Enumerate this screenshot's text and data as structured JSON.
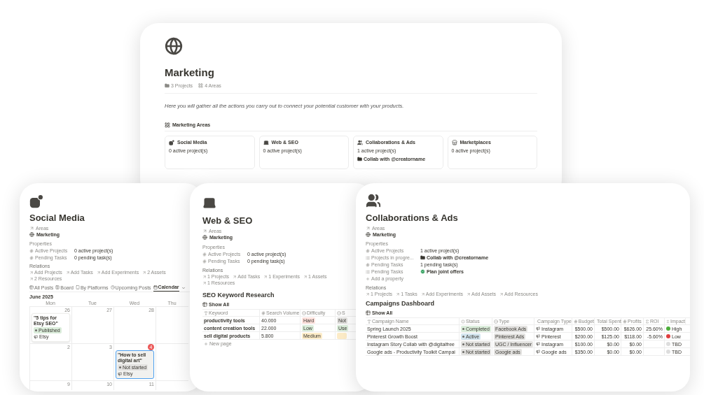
{
  "marketing": {
    "title": "Marketing",
    "meta": [
      {
        "kind": "projects",
        "label": "3 Projects"
      },
      {
        "kind": "areas",
        "label": "4 Areas"
      }
    ],
    "description": "Here you will gather all the actions you carry out to connect your potential customer with your products.",
    "section": "Marketing Areas",
    "areas": [
      {
        "kind": "social",
        "name": "Social Media",
        "count": "0 active project(s)"
      },
      {
        "kind": "web",
        "name": "Web & SEO",
        "count": "0 active project(s)"
      },
      {
        "kind": "collab",
        "name": "Collaborations & Ads",
        "count": "1 active project(s)",
        "project": "Collab with @creatorname"
      },
      {
        "kind": "market",
        "name": "Marketplaces",
        "count": "0 active project(s)"
      }
    ]
  },
  "social": {
    "title": "Social Media",
    "areas_label": "Areas",
    "area": "Marketing",
    "properties_label": "Properties",
    "properties": [
      {
        "kind": "number",
        "label": "Active Projects",
        "value": "0 active project(s)"
      },
      {
        "kind": "number",
        "label": "Pending Tasks",
        "value": "0 pending task(s)"
      }
    ],
    "relations_label": "Relations",
    "relations": [
      "Add Projects",
      "Add Tasks",
      "Add Experiments",
      "2 Assets",
      "2 Resources"
    ],
    "views": [
      {
        "kind": "table",
        "label": "All Posts",
        "selected": false
      },
      {
        "kind": "board",
        "label": "Board",
        "selected": false
      },
      {
        "kind": "platforms",
        "label": "By Platforms",
        "selected": false
      },
      {
        "kind": "upcoming",
        "label": "Upcoming Posts",
        "selected": false
      },
      {
        "kind": "calendar",
        "label": "Calendar",
        "selected": true
      }
    ],
    "calendar": {
      "month": "June 2025",
      "weekdays": [
        "Mon",
        "Tue",
        "Wed",
        "Thu"
      ],
      "weeks": [
        [
          {
            "day": "26",
            "today": false,
            "event": {
              "title": "\"5 tips for Etsy SEO\"",
              "status": "Published",
              "color": "#dbeddb",
              "platform": "Etsy",
              "selected": false
            }
          },
          {
            "day": "27",
            "today": false
          },
          {
            "day": "28",
            "today": false
          }
        ],
        [
          {
            "day": "2",
            "today": false
          },
          {
            "day": "3",
            "today": false
          },
          {
            "day": "4",
            "today": true,
            "event": {
              "title": "\"How to sell digital art\"",
              "status": "Not started",
              "color": "#e3e2e0",
              "platform": "Etsy",
              "selected": true
            }
          }
        ],
        [
          {
            "day": "9",
            "today": false
          },
          {
            "day": "10",
            "today": false
          },
          {
            "day": "11",
            "today": false
          }
        ]
      ]
    }
  },
  "web": {
    "title": "Web & SEO",
    "areas_label": "Areas",
    "area": "Marketing",
    "properties_label": "Properties",
    "properties": [
      {
        "kind": "number",
        "label": "Active Projects",
        "value": "0 active project(s)"
      },
      {
        "kind": "number",
        "label": "Pending Tasks",
        "value": "0 pending task(s)"
      }
    ],
    "relations_label": "Relations",
    "relations": [
      "1 Projects",
      "Add Tasks",
      "1 Experiments",
      "1 Assets",
      "1 Resources"
    ],
    "table": {
      "title": "SEO Keyword Research",
      "view": "Show All",
      "columns": [
        {
          "kind": "title",
          "label": "Keyword"
        },
        {
          "kind": "number",
          "label": "Search Volume"
        },
        {
          "kind": "select",
          "label": "Difficulty"
        },
        {
          "kind": "select",
          "label": "S"
        }
      ],
      "rows": [
        {
          "keyword": "productivity tools",
          "volume": "40.000",
          "difficulty": {
            "text": "Hard",
            "color": "#ffe2dd"
          },
          "column_4": {
            "text": "Not",
            "color": "#e3e2e0"
          }
        },
        {
          "keyword": "content creation tools",
          "volume": "22.000",
          "difficulty": {
            "text": "Low",
            "color": "#dbeddb"
          },
          "column_4": {
            "text": "Use",
            "color": "#dbeddb"
          }
        },
        {
          "keyword": "sell digital products",
          "volume": "5.800",
          "difficulty": {
            "text": "Medium",
            "color": "#fdecc8"
          },
          "column_4": {
            "color": "#fdecc8"
          }
        }
      ],
      "new_row": "New page"
    }
  },
  "collab": {
    "title": "Collaborations & Ads",
    "areas_label": "Areas",
    "area": "Marketing",
    "properties_label": "Properties",
    "properties": [
      {
        "kind": "number",
        "label": "Active Projects",
        "value": "1 active project(s)"
      },
      {
        "kind": "relation",
        "label": "Projects in progre...",
        "value": {
          "kind": "project",
          "text": "Collab with @creatorname"
        }
      },
      {
        "kind": "number",
        "label": "Pending Tasks",
        "value": "1 pending task(s)"
      },
      {
        "kind": "relation",
        "label": "Pending Tasks",
        "value": {
          "kind": "task",
          "text": "Plan joint offers"
        }
      }
    ],
    "add_property": "Add a property",
    "relations_label": "Relations",
    "relations": [
      "1 Projects",
      "1 Tasks",
      "Add Experiments",
      "Add Assets",
      "Add Resources"
    ],
    "table": {
      "title": "Campaigns Dashboard",
      "view": "Show All",
      "columns": [
        {
          "kind": "title",
          "label": "Campaign Name"
        },
        {
          "kind": "status",
          "label": "Status"
        },
        {
          "kind": "select",
          "label": "Type"
        },
        {
          "kind": "relation",
          "label": "Campaign Type"
        },
        {
          "kind": "number",
          "label": "Budget"
        },
        {
          "kind": "number",
          "label": "Total Spent"
        },
        {
          "kind": "number",
          "label": "Profits"
        },
        {
          "kind": "formula",
          "label": "ROI"
        },
        {
          "kind": "formula",
          "label": "Impact"
        }
      ],
      "rows": [
        {
          "name": "Spring Launch 2025",
          "status": {
            "text": "Completed",
            "color": "#dbeddb"
          },
          "type": "Facebook Ads",
          "campaign_type": "Instagram",
          "budget": "$500.00",
          "spent": "$500.00",
          "profits": "$626.00",
          "roi": "25.60%",
          "impact": {
            "text": "High",
            "color": "#4caf3a"
          }
        },
        {
          "name": "Pinterest Growth Boost",
          "status": {
            "text": "Active",
            "color": "#d3e5ef"
          },
          "type": "Pinterest Ads",
          "campaign_type": "Pinterest",
          "budget": "$200.00",
          "spent": "$125.00",
          "profits": "$118.00",
          "roi": "-5.60%",
          "impact": {
            "text": "Low",
            "color": "#e03e3e"
          }
        },
        {
          "name": "Instagram Story Collab with @digitalfree",
          "status": {
            "text": "Not started",
            "color": "#e3e2e0"
          },
          "type": "UGC / Influencer",
          "campaign_type": "Instagram",
          "budget": "$100.00",
          "spent": "$0.00",
          "profits": "$0.00",
          "impact": {
            "text": "TBD",
            "color": "#dddddd"
          }
        },
        {
          "name": "Google ads - Productivity Toolkit Campai",
          "status": {
            "text": "Not started",
            "color": "#e3e2e0"
          },
          "type": "Google ads",
          "campaign_type": "Google ads",
          "budget": "$350.00",
          "spent": "$0.00",
          "profits": "$0.00",
          "impact": {
            "text": "TBD",
            "color": "#dddddd"
          }
        }
      ]
    }
  }
}
